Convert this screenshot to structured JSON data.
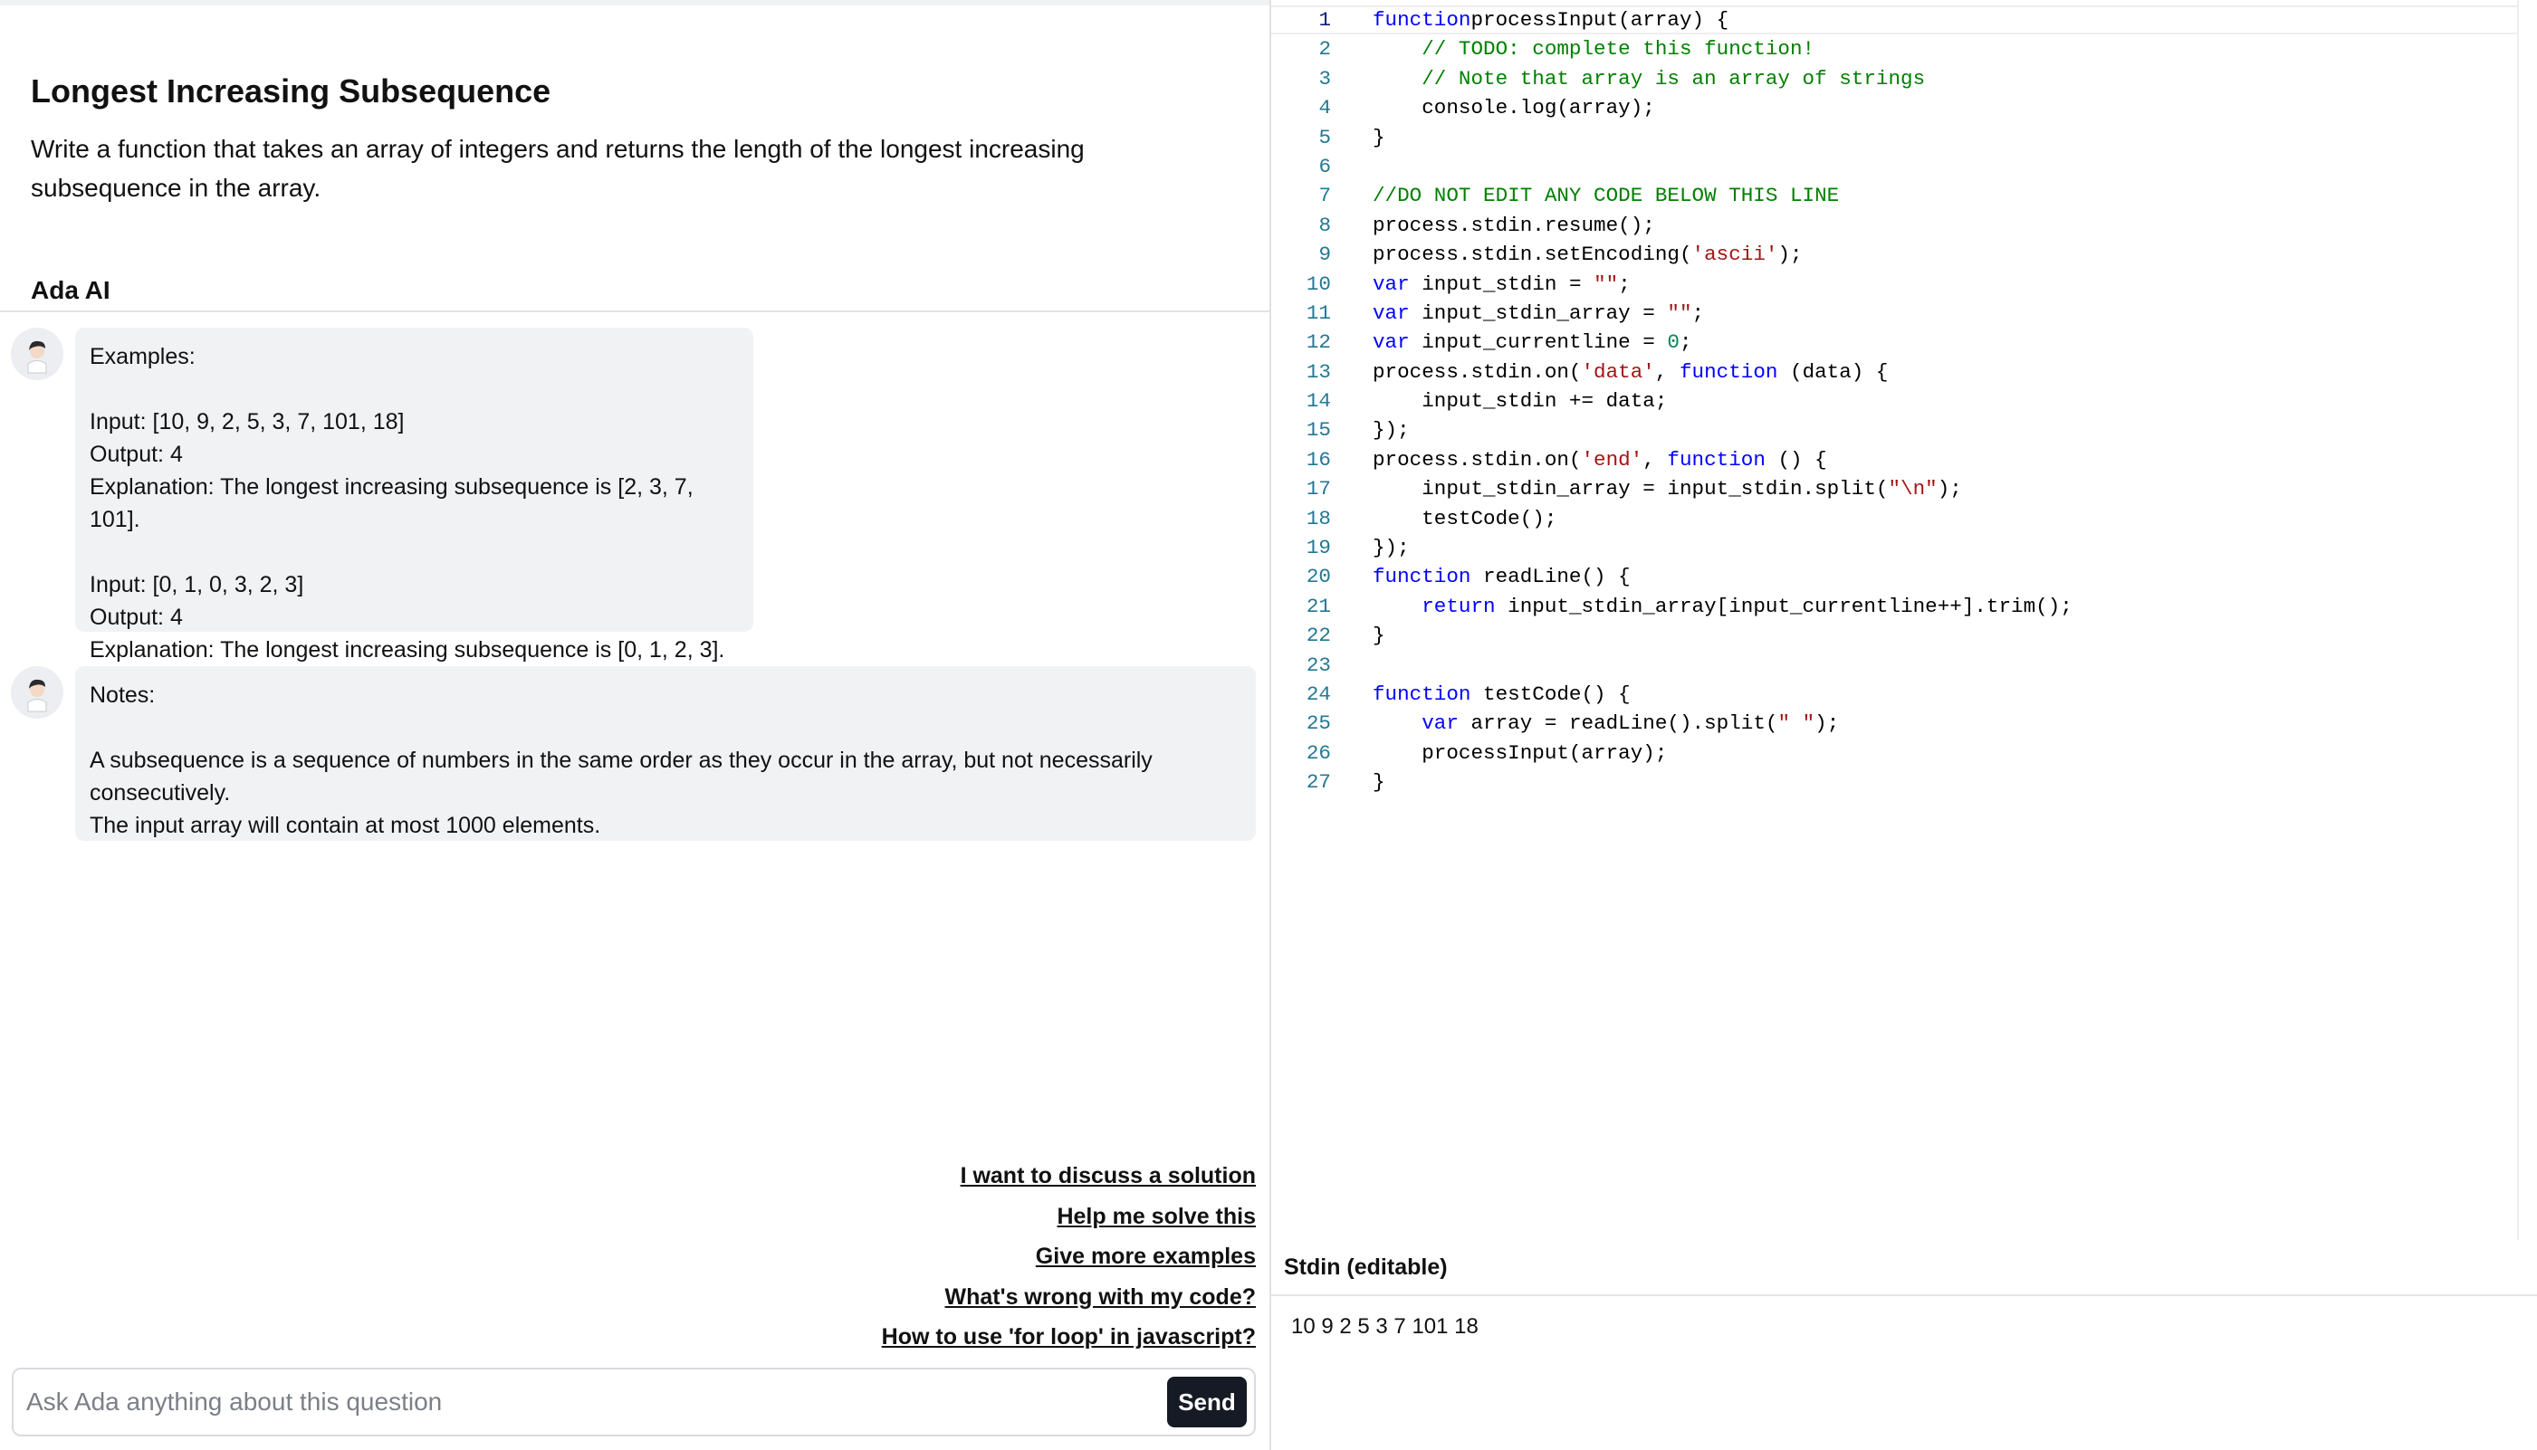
{
  "question": {
    "title": "Longest Increasing Subsequence",
    "description": "Write a function that takes an array of integers and returns the length of the longest increasing subsequence in the array."
  },
  "chat": {
    "header": "Ada AI",
    "messages": [
      {
        "lines": [
          "Examples:",
          "",
          "Input: [10, 9, 2, 5, 3, 7, 101, 18]",
          "Output: 4",
          "Explanation: The longest increasing subsequence is [2, 3, 7, 101].",
          "",
          "Input: [0, 1, 0, 3, 2, 3]",
          "Output: 4",
          "Explanation: The longest increasing subsequence is [0, 1, 2, 3]."
        ]
      },
      {
        "lines": [
          "Notes:",
          "",
          "A subsequence is a sequence of numbers in the same order as they occur in the array, but not necessarily",
          "consecutively.",
          "The input array will contain at most 1000 elements."
        ]
      }
    ],
    "suggestions": [
      "I want to discuss a solution",
      "Help me solve this",
      "Give more examples",
      "What's wrong with my code?",
      "How to use 'for loop' in javascript?"
    ],
    "input": {
      "value": "",
      "placeholder": "Ask Ada anything about this question"
    },
    "send_label": "Send"
  },
  "editor": {
    "active_line": 1,
    "lines": [
      [
        [
          "kw",
          "function"
        ],
        [
          "",
          "processInput(array) {"
        ]
      ],
      [
        [
          "",
          "    "
        ],
        [
          "cm",
          "// TODO: complete this function!"
        ]
      ],
      [
        [
          "",
          "    "
        ],
        [
          "cm",
          "// Note that array is an array of strings"
        ]
      ],
      [
        [
          "",
          "    console.log(array);"
        ]
      ],
      [
        [
          "",
          "}"
        ]
      ],
      [],
      [
        [
          "cm",
          "//DO NOT EDIT ANY CODE BELOW THIS LINE"
        ]
      ],
      [
        [
          "",
          "process.stdin.resume();"
        ]
      ],
      [
        [
          "",
          "process.stdin.setEncoding("
        ],
        [
          "str",
          "'ascii'"
        ],
        [
          "",
          ");"
        ]
      ],
      [
        [
          "kw",
          "var"
        ],
        [
          "",
          " input_stdin = "
        ],
        [
          "str",
          "\"\""
        ],
        [
          "",
          ";"
        ]
      ],
      [
        [
          "kw",
          "var"
        ],
        [
          "",
          " input_stdin_array = "
        ],
        [
          "str",
          "\"\""
        ],
        [
          "",
          ";"
        ]
      ],
      [
        [
          "kw",
          "var"
        ],
        [
          "",
          " input_currentline = "
        ],
        [
          "num",
          "0"
        ],
        [
          "",
          ";"
        ]
      ],
      [
        [
          "",
          "process.stdin.on("
        ],
        [
          "str",
          "'data'"
        ],
        [
          "",
          ", "
        ],
        [
          "kw",
          "function"
        ],
        [
          "",
          " (data) {"
        ]
      ],
      [
        [
          "",
          "    input_stdin += data;"
        ]
      ],
      [
        [
          "",
          "});"
        ]
      ],
      [
        [
          "",
          "process.stdin.on("
        ],
        [
          "str",
          "'end'"
        ],
        [
          "",
          ", "
        ],
        [
          "kw",
          "function"
        ],
        [
          "",
          " () {"
        ]
      ],
      [
        [
          "",
          "    input_stdin_array = input_stdin.split("
        ],
        [
          "str",
          "\"\\n\""
        ],
        [
          "",
          ");"
        ]
      ],
      [
        [
          "",
          "    testCode();"
        ]
      ],
      [
        [
          "",
          "});"
        ]
      ],
      [
        [
          "kw",
          "function"
        ],
        [
          "",
          " readLine() {"
        ]
      ],
      [
        [
          "",
          "    "
        ],
        [
          "kw",
          "return"
        ],
        [
          "",
          " input_stdin_array[input_currentline++].trim();"
        ]
      ],
      [
        [
          "",
          "}"
        ]
      ],
      [],
      [
        [
          "kw",
          "function"
        ],
        [
          "",
          " testCode() {"
        ]
      ],
      [
        [
          "",
          "    "
        ],
        [
          "kw",
          "var"
        ],
        [
          "",
          " array = readLine().split("
        ],
        [
          "str",
          "\" \""
        ],
        [
          "",
          ");"
        ]
      ],
      [
        [
          "",
          "    processInput(array);"
        ]
      ],
      [
        [
          "",
          "}"
        ]
      ]
    ]
  },
  "stdin": {
    "label": "Stdin (editable)",
    "value": "10 9 2 5 3 7 101 18"
  }
}
